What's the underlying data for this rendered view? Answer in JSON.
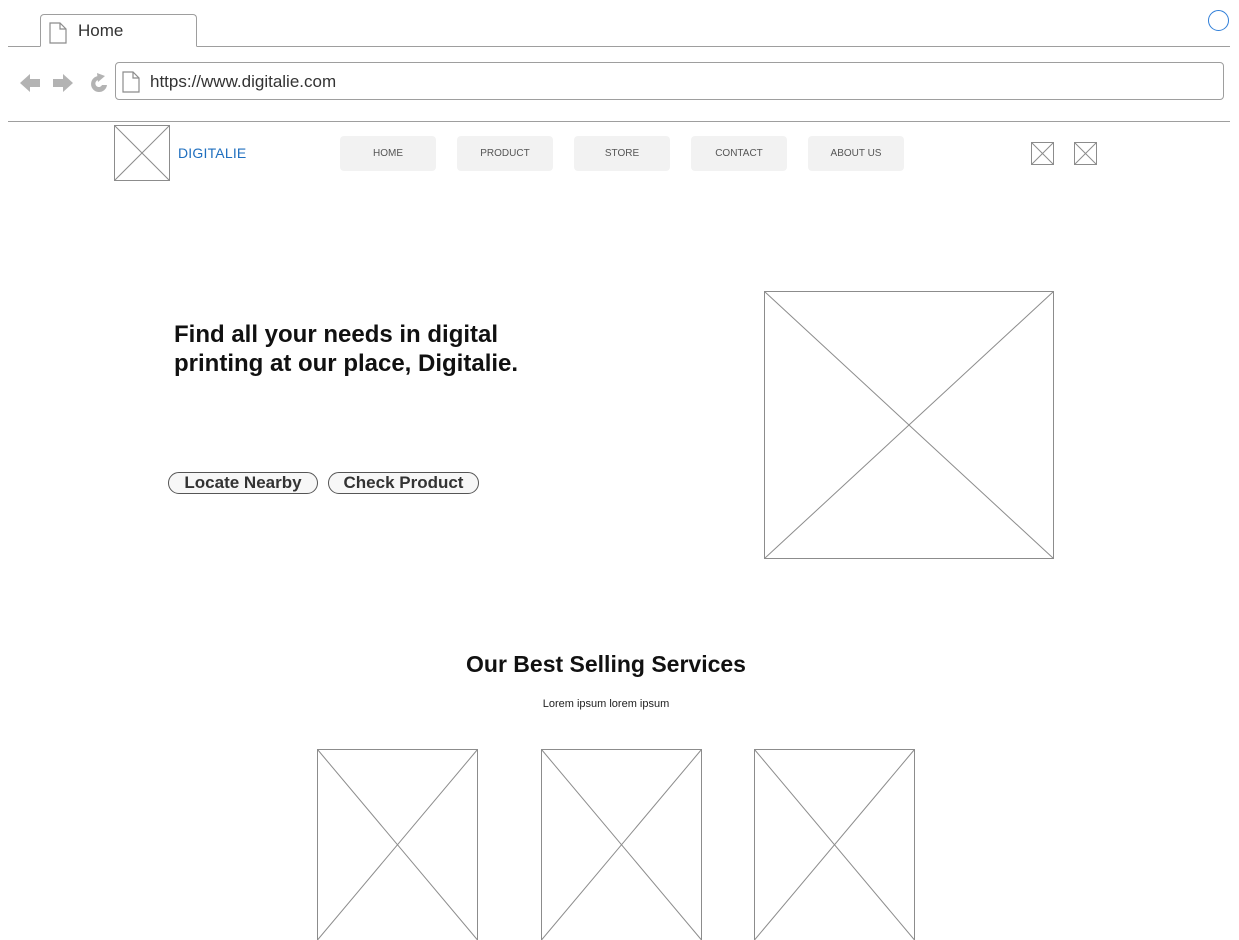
{
  "browser": {
    "tab_label": "Home",
    "url": "https://www.digitalie.com"
  },
  "site": {
    "brand": "DIGITALIE",
    "nav": [
      "HOME",
      "PRODUCT",
      "STORE",
      "CONTACT",
      "ABOUT US"
    ]
  },
  "hero": {
    "title": "Find all your needs in digital printing at our place, Digitalie.",
    "buttons": [
      "Locate Nearby",
      "Check Product"
    ]
  },
  "services": {
    "title": "Our Best Selling Services",
    "subtitle": "Lorem ipsum lorem ipsum"
  },
  "colors": {
    "brand": "#1f6fbf",
    "status_circle": "#2f7ed8",
    "placeholder_stroke": "#8c8c8c",
    "nav_button_bg": "#f2f2f2"
  }
}
